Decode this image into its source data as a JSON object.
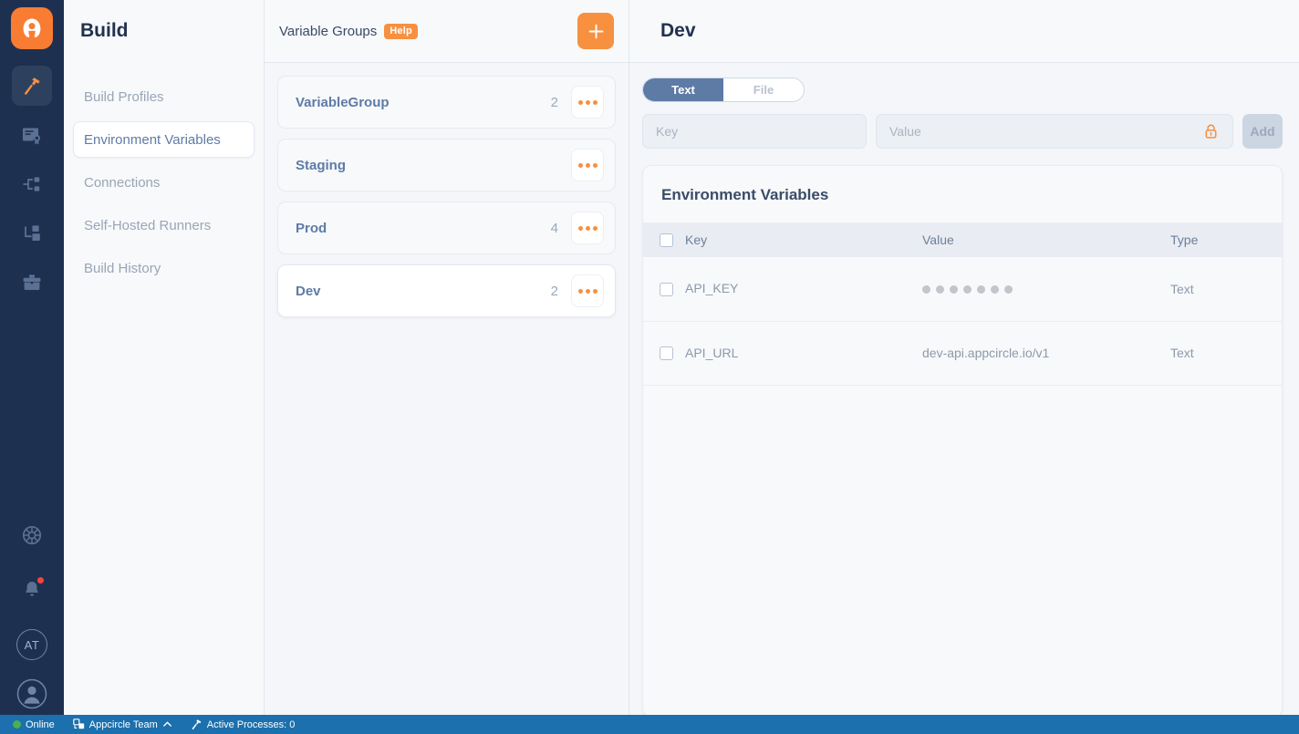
{
  "brand": {
    "logo_name": "appcircle-logo",
    "accent": "#f7903f",
    "rail_bg": "#1e3050"
  },
  "rail": {
    "items": [
      {
        "icon": "hammer-icon",
        "name": "build",
        "active": true
      },
      {
        "icon": "certificate-icon",
        "name": "signing-identities",
        "active": false
      },
      {
        "icon": "distribution-icon",
        "name": "distribution",
        "active": false
      },
      {
        "icon": "store-submit-icon",
        "name": "store-submit",
        "active": false
      },
      {
        "icon": "briefcase-icon",
        "name": "enterprise-app-store",
        "active": false
      }
    ],
    "bottom": [
      {
        "icon": "lifebuoy-icon",
        "name": "support"
      },
      {
        "icon": "bell-icon",
        "name": "notifications",
        "badge": true
      },
      {
        "icon": "org-avatar",
        "name": "organization",
        "initials": "AT"
      },
      {
        "icon": "user-icon",
        "name": "account"
      }
    ]
  },
  "nav": {
    "title": "Build",
    "items": [
      {
        "label": "Build Profiles",
        "selected": false
      },
      {
        "label": "Environment Variables",
        "selected": true
      },
      {
        "label": "Connections",
        "selected": false
      },
      {
        "label": "Self-Hosted Runners",
        "selected": false
      },
      {
        "label": "Build History",
        "selected": false
      }
    ]
  },
  "groups": {
    "title": "Variable Groups",
    "help_label": "Help",
    "add_label": "+",
    "items": [
      {
        "name": "VariableGroup",
        "count": "2",
        "selected": false
      },
      {
        "name": "Staging",
        "count": "",
        "selected": false
      },
      {
        "name": "Prod",
        "count": "4",
        "selected": false
      },
      {
        "name": "Dev",
        "count": "2",
        "selected": true
      }
    ]
  },
  "detail": {
    "title": "Dev",
    "tabs": [
      {
        "label": "Text",
        "active": true
      },
      {
        "label": "File",
        "active": false
      }
    ],
    "key_placeholder": "Key",
    "key_value": "",
    "value_placeholder": "Value",
    "value_value": "",
    "lock_icon": "lock-icon",
    "add_label": "Add",
    "table": {
      "title": "Environment Variables",
      "columns": [
        "Key",
        "Value",
        "Type"
      ],
      "rows": [
        {
          "key": "API_KEY",
          "value": "",
          "masked": true,
          "mask_dots": 7,
          "type": "Text"
        },
        {
          "key": "API_URL",
          "value": "dev-api.appcircle.io/v1",
          "masked": false,
          "mask_dots": 0,
          "type": "Text"
        }
      ]
    }
  },
  "statusbar": {
    "online_label": "Online",
    "team_label": "Appcircle Team",
    "team_chevron": "chevron-up-icon",
    "processes_label": "Active Processes: 0"
  }
}
